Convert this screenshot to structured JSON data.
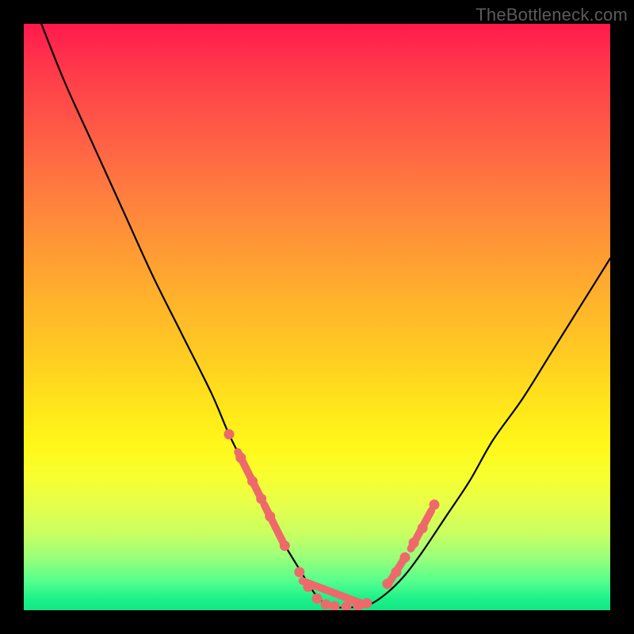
{
  "watermark": "TheBottleneck.com",
  "chart_data": {
    "type": "line",
    "title": "",
    "xlabel": "",
    "ylabel": "",
    "xlim": [
      0,
      100
    ],
    "ylim": [
      0,
      100
    ],
    "legend": false,
    "grid": false,
    "series": [
      {
        "name": "bottleneck-curve",
        "color": "#000000",
        "x": [
          3,
          7,
          12,
          17,
          22,
          27,
          32,
          35,
          38,
          41,
          44,
          47,
          49.5,
          51.5,
          53.5,
          56,
          59,
          62,
          65,
          68,
          72,
          76,
          80,
          85,
          90,
          95,
          100
        ],
        "y": [
          100,
          90,
          79,
          68,
          57,
          47,
          37,
          30,
          24,
          18,
          12,
          7,
          3,
          1,
          0.5,
          0.5,
          1,
          3,
          6,
          10,
          16,
          22,
          29,
          36,
          44,
          52,
          60
        ]
      },
      {
        "name": "marker-dots",
        "type": "scatter",
        "color": "#ee6a6a",
        "x": [
          35,
          37,
          39,
          40.5,
          42,
          44.5,
          47,
          48.5,
          50,
          51.5,
          53,
          55,
          57,
          58.5,
          62,
          63.5,
          65,
          66.5,
          68,
          70
        ],
        "y": [
          30,
          26,
          22,
          19,
          16,
          11,
          6.5,
          4,
          2,
          1,
          0.7,
          0.6,
          0.7,
          1.2,
          4.5,
          6.5,
          9,
          11.5,
          14,
          18
        ]
      },
      {
        "name": "marker-segments",
        "type": "line",
        "color": "#ee6a6a",
        "stroke_width": 6,
        "segments": [
          {
            "x": [
              36.5,
              40.5
            ],
            "y": [
              27,
              19
            ]
          },
          {
            "x": [
              41,
              44.5
            ],
            "y": [
              18,
              11
            ]
          },
          {
            "x": [
              47.5,
              58
            ],
            "y": [
              5,
              1
            ]
          },
          {
            "x": [
              62.5,
              65
            ],
            "y": [
              5,
              9
            ]
          },
          {
            "x": [
              66,
              69.5
            ],
            "y": [
              10.5,
              17
            ]
          }
        ]
      }
    ]
  }
}
